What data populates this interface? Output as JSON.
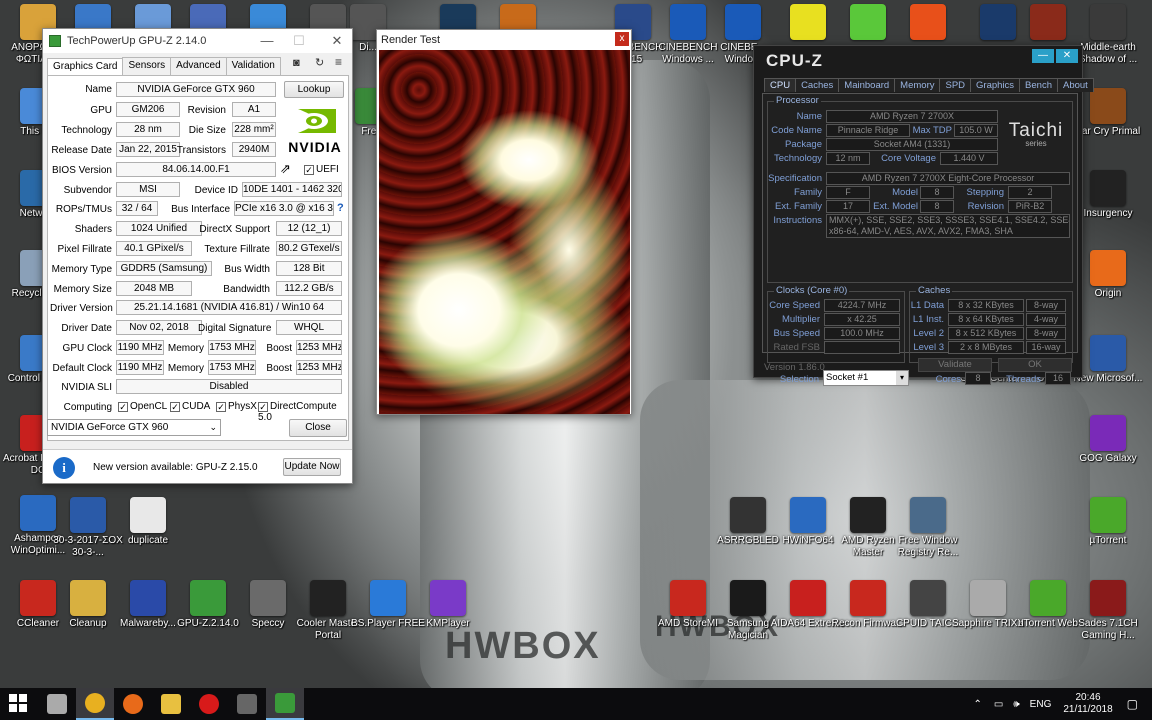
{
  "desktop": {
    "icons_left": [
      {
        "label": "ΑΝΘΡΩΠΟΙ ΦΩΤΙΑΔΑ",
        "color": "#d9a23a"
      },
      {
        "label": "",
        "color": "#3a78c8"
      },
      {
        "label": "",
        "color": "#6a9ad8"
      },
      {
        "label": "",
        "color": "#4a6ab8"
      },
      {
        "label": "",
        "color": "#3a8ad8"
      },
      {
        "label": "",
        "color": "#555"
      },
      {
        "label": "This PC",
        "color": "#4a8ad8"
      },
      {
        "label": "Network",
        "color": "#2a6aa8"
      },
      {
        "label": "Recycle Bin",
        "color": "#8aa0b8"
      },
      {
        "label": "Control Panel",
        "color": "#3a7ac8"
      },
      {
        "label": "Acrobat Reader DC",
        "color": "#c8201e"
      },
      {
        "label": "Ashampoo WinOptimi...",
        "color": "#2a6ac0"
      },
      {
        "label": "30-3-2017-ΣΟΧ 30-3-...",
        "color": "#2a5aa8"
      },
      {
        "label": "duplicate",
        "color": "#e8e8e8"
      },
      {
        "label": "CCleaner",
        "color": "#c8281e"
      },
      {
        "label": "Cleanup",
        "color": "#d8b040"
      },
      {
        "label": "Malwareby...",
        "color": "#2a4aa8"
      },
      {
        "label": "GPU-Z.2.14.0",
        "color": "#3a9a3a"
      },
      {
        "label": "Speccy",
        "color": "#6a6a6a"
      },
      {
        "label": "Cooler Master Portal",
        "color": "#222"
      },
      {
        "label": "BS.Player FREE",
        "color": "#2a7ad8"
      },
      {
        "label": "KMPlayer",
        "color": "#7a3ac8"
      }
    ],
    "icons_right": [
      {
        "label": "Middle-earth Shadow of ...",
        "color": "#3a3a3a"
      },
      {
        "label": "Far Cry Primal",
        "color": "#8a4a1a"
      },
      {
        "label": "Insurgency",
        "color": "#222"
      },
      {
        "label": "Origin",
        "color": "#e86a1a"
      },
      {
        "label": "New Microsof...",
        "color": "#2a5aa8"
      },
      {
        "label": "GOG Galaxy",
        "color": "#7a2ab8"
      },
      {
        "label": "µTorrent",
        "color": "#4aa82a"
      },
      {
        "label": "ASRRGBLED",
        "color": "#333"
      },
      {
        "label": "HWiNFO64",
        "color": "#2a6ac0"
      },
      {
        "label": "AMD Ryzen Master",
        "color": "#222"
      },
      {
        "label": "Free Window Registry Re...",
        "color": "#4a6a8a"
      },
      {
        "label": "AMD StoreMI",
        "color": "#c8281e"
      },
      {
        "label": "Samsung Magician",
        "color": "#1a1a1a"
      },
      {
        "label": "AIDA64 Extreme",
        "color": "#c8201e"
      },
      {
        "label": "Recon Firmwa...",
        "color": "#c8281e"
      },
      {
        "label": "CPUID TAIC...",
        "color": "#444"
      },
      {
        "label": "Sapphire TRIXX",
        "color": "#aaa"
      },
      {
        "label": "uTorrent Web",
        "color": "#4aa82a"
      },
      {
        "label": "Sades 7.1CH Gaming H...",
        "color": "#8a1a1a"
      },
      {
        "label": "Game Center",
        "color": "#333"
      },
      {
        "label": "Uplay",
        "color": "#2a4aa8"
      }
    ],
    "icons_top": [
      {
        "label": "Di...",
        "color": "#555"
      },
      {
        "label": "",
        "color": "#1a3a5a"
      },
      {
        "label": "",
        "color": "#c86a1a"
      },
      {
        "label": "CINEBENCH R15",
        "color": "#2a4a8a"
      },
      {
        "label": "CINEBENCH Windows ...",
        "color": "#1a5ab8"
      },
      {
        "label": "CINEBE... Windo...",
        "color": "#1a5ab8"
      },
      {
        "label": "",
        "color": "#e8e020"
      },
      {
        "label": "",
        "color": "#5ac83a"
      },
      {
        "label": "",
        "color": "#e8501a"
      },
      {
        "label": "",
        "color": "#1a3a6a"
      },
      {
        "label": "",
        "color": "#8a2a1a"
      },
      {
        "label": "Fre...",
        "color": "#3a8a3a"
      }
    ]
  },
  "gpuz": {
    "title": "TechPowerUp GPU-Z 2.14.0",
    "tabs": [
      "Graphics Card",
      "Sensors",
      "Advanced",
      "Validation"
    ],
    "lookup": "Lookup",
    "logo": "NVIDIA",
    "rows": {
      "name_l": "Name",
      "name_v": "NVIDIA GeForce GTX 960",
      "gpu_l": "GPU",
      "gpu_v": "GM206",
      "rev_l": "Revision",
      "rev_v": "A1",
      "tech_l": "Technology",
      "tech_v": "28 nm",
      "die_l": "Die Size",
      "die_v": "228 mm²",
      "rel_l": "Release Date",
      "rel_v": "Jan 22, 2015",
      "tr_l": "Transistors",
      "tr_v": "2940M",
      "bios_l": "BIOS Version",
      "bios_v": "84.06.14.00.F1",
      "uefi": "UEFI",
      "sub_l": "Subvendor",
      "sub_v": "MSI",
      "dev_l": "Device ID",
      "dev_v": "10DE 1401 - 1462 3202",
      "rop_l": "ROPs/TMUs",
      "rop_v": "32 / 64",
      "bus_l": "Bus Interface",
      "bus_v": "PCIe x16 3.0 @ x16 3.0",
      "sh_l": "Shaders",
      "sh_v": "1024 Unified",
      "dx_l": "DirectX Support",
      "dx_v": "12 (12_1)",
      "pf_l": "Pixel Fillrate",
      "pf_v": "40.1 GPixel/s",
      "tf_l": "Texture Fillrate",
      "tf_v": "80.2 GTexel/s",
      "mt_l": "Memory Type",
      "mt_v": "GDDR5 (Samsung)",
      "bw_l": "Bus Width",
      "bw_v": "128 Bit",
      "ms_l": "Memory Size",
      "ms_v": "2048 MB",
      "band_l": "Bandwidth",
      "band_v": "112.2 GB/s",
      "drv_l": "Driver Version",
      "drv_v": "25.21.14.1681 (NVIDIA 416.81) / Win10 64",
      "dd_l": "Driver Date",
      "dd_v": "Nov 02, 2018",
      "ds_l": "Digital Signature",
      "ds_v": "WHQL",
      "gc_l": "GPU Clock",
      "gc_v": "1190 MHz",
      "mem_l": "Memory",
      "mem_v": "1753 MHz",
      "bo_l": "Boost",
      "bo_v": "1253 MHz",
      "dc_l": "Default Clock",
      "dc_v": "1190 MHz",
      "mem2_v": "1753 MHz",
      "bo2_v": "1253 MHz",
      "sli_l": "NVIDIA SLI",
      "sli_v": "Disabled",
      "comp_l": "Computing",
      "c1": "OpenCL",
      "c2": "CUDA",
      "c3": "PhysX",
      "c4": "DirectCompute 5.0"
    },
    "select": "NVIDIA GeForce GTX 960",
    "close": "Close",
    "update_text": "New version available: GPU-Z 2.15.0",
    "update_btn": "Update Now"
  },
  "render": {
    "title": "Render Test",
    "close": "x"
  },
  "cpuz": {
    "title": "CPU-Z",
    "tabs": [
      "CPU",
      "Caches",
      "Mainboard",
      "Memory",
      "SPD",
      "Graphics",
      "Bench",
      "About"
    ],
    "processor": "Processor",
    "name_l": "Name",
    "name_v": "AMD Ryzen 7 2700X",
    "code_l": "Code Name",
    "code_v": "Pinnacle Ridge",
    "tdp_l": "Max TDP",
    "tdp_v": "105.0 W",
    "pkg_l": "Package",
    "pkg_v": "Socket AM4 (1331)",
    "tech_l": "Technology",
    "tech_v": "12 nm",
    "cv_l": "Core Voltage",
    "cv_v": "1.440 V",
    "spec_l": "Specification",
    "spec_v": "AMD Ryzen 7 2700X Eight-Core Processor",
    "fam_l": "Family",
    "fam_v": "F",
    "mod_l": "Model",
    "mod_v": "8",
    "step_l": "Stepping",
    "step_v": "2",
    "efam_l": "Ext. Family",
    "efam_v": "17",
    "emod_l": "Ext. Model",
    "emod_v": "8",
    "rev_l": "Revision",
    "rev_v": "PiR-B2",
    "ins_l": "Instructions",
    "ins_v1": "MMX(+), SSE, SSE2, SSE3, SSSE3, SSE4.1, SSE4.2, SSE4A,",
    "ins_v2": "x86-64, AMD-V, AES, AVX, AVX2, FMA3, SHA",
    "clocks": "Clocks (Core #0)",
    "cs_l": "Core Speed",
    "cs_v": "4224.7 MHz",
    "mul_l": "Multiplier",
    "mul_v": "x 42.25",
    "bs_l": "Bus Speed",
    "bs_v": "100.0 MHz",
    "fsb_l": "Rated FSB",
    "fsb_v": "",
    "caches": "Caches",
    "l1d_l": "L1 Data",
    "l1d_v": "8 x 32 KBytes",
    "l1d_w": "8-way",
    "l1i_l": "L1 Inst.",
    "l1i_v": "8 x 64 KBytes",
    "l1i_w": "4-way",
    "l2_l": "Level 2",
    "l2_v": "8 x 512 KBytes",
    "l2_w": "8-way",
    "l3_l": "Level 3",
    "l3_v": "2 x 8 MBytes",
    "l3_w": "16-way",
    "sel_l": "Selection",
    "sel_v": "Socket #1",
    "cores_l": "Cores",
    "cores_v": "8",
    "thr_l": "Threads",
    "thr_v": "16",
    "version": "Version 1.86.0",
    "validate": "Validate",
    "ok": "OK",
    "brand1": "Taichi",
    "brand2": "series"
  },
  "background": {
    "text1": "HWBOX",
    "text2": "HWBOX"
  },
  "taskbar": {
    "items": [
      {
        "name": "start",
        "color": "#fff"
      },
      {
        "name": "search",
        "color": "#aaa"
      },
      {
        "name": "chrome",
        "color": "#e8b020"
      },
      {
        "name": "firefox",
        "color": "#e86a1a"
      },
      {
        "name": "explorer",
        "color": "#e8c040"
      },
      {
        "name": "opera",
        "color": "#d81a1a"
      },
      {
        "name": "app",
        "color": "#666"
      },
      {
        "name": "gpuz",
        "color": "#3a9a3a"
      }
    ],
    "lang": "ENG",
    "time": "20:46",
    "date": "21/11/2018"
  }
}
